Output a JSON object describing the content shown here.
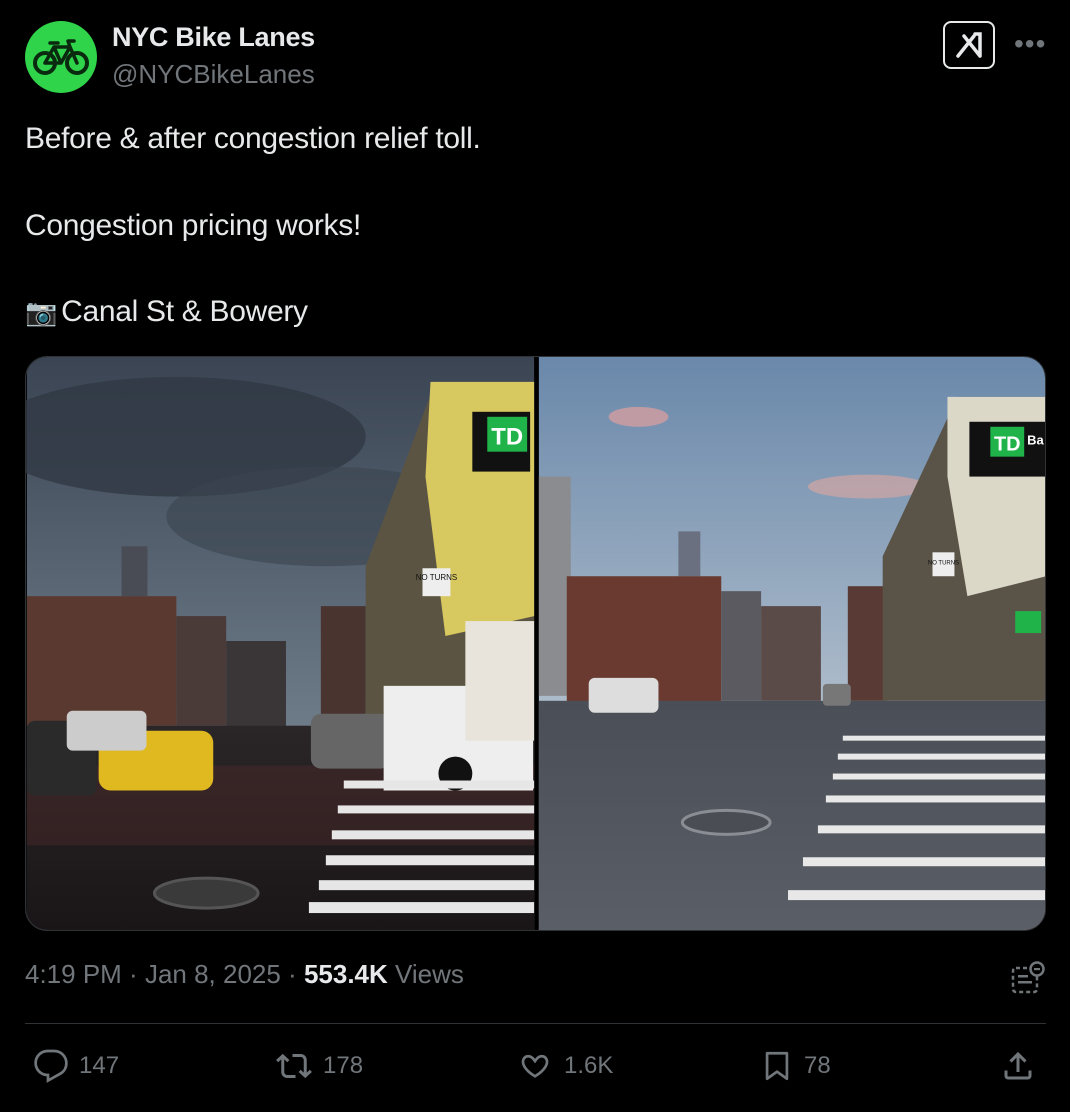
{
  "author": {
    "name": "NYC Bike Lanes",
    "handle": "@NYCBikeLanes",
    "avatar_color": "#2fd44a"
  },
  "tweet": {
    "line1": "Before & after congestion relief toll.",
    "line2": "Congestion pricing works!",
    "line3_icon": "📷",
    "line3": "Canal St & Bowery"
  },
  "media": {
    "left_sign": "NO TURNS",
    "left_logo": "TD",
    "right_sign": "NO TURNS",
    "right_logo": "TD",
    "right_logo_text": "Ba"
  },
  "meta": {
    "time": "4:19 PM",
    "sep1": " · ",
    "date": "Jan 8, 2025",
    "sep2": " · ",
    "views_count": "553.4K",
    "views_label": " Views"
  },
  "actions": {
    "replies": "147",
    "reposts": "178",
    "likes": "1.6K",
    "bookmarks": "78"
  },
  "colors": {
    "background": "#000000",
    "text": "#e7e9ea",
    "secondary": "#71767b",
    "divider": "#2f3336"
  }
}
